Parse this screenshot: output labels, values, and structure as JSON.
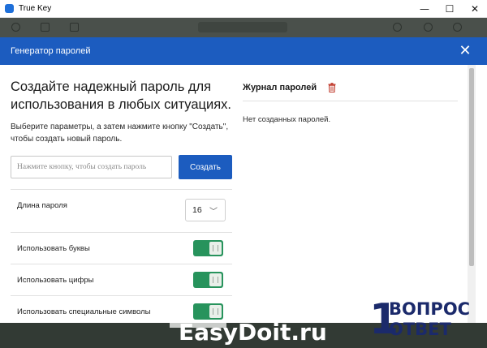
{
  "window": {
    "title": "True Key",
    "minimize_glyph": "—",
    "maximize_glyph": "☐",
    "close_glyph": "✕"
  },
  "dialog": {
    "title": "Генератор паролей",
    "close_glyph": "✕"
  },
  "generator": {
    "heading": "Создайте надежный пароль для использования в любых ситуациях.",
    "subtext": "Выберите параметры, а затем нажмите кнопку \"Создать\", чтобы создать новый пароль.",
    "input_placeholder": "Нажмите кнопку, чтобы создать пароль",
    "input_value": "",
    "create_label": "Создать",
    "options": {
      "length_label": "Длина пароля",
      "length_value": "16",
      "letters_label": "Использовать буквы",
      "letters_on": true,
      "digits_label": "Использовать цифры",
      "digits_on": true,
      "special_label": "Использовать специальные символы",
      "special_on": true
    }
  },
  "history": {
    "title": "Журнал паролей",
    "empty_text": "Нет созданных паролей."
  },
  "watermark": {
    "site": "EasyDoit.ru",
    "badge_digit": "1",
    "badge_line1": "ВОПРОС",
    "badge_line2": "ОТВЕТ"
  },
  "colors": {
    "accent": "#1c5cbf",
    "toggle_on": "#27935c",
    "dim_overlay": "#4a504b",
    "watermark_blue": "#1b2a6b"
  },
  "icons": {
    "app": "true-key-icon",
    "trash": "trash-icon",
    "chevron": "chevron-down-icon"
  }
}
